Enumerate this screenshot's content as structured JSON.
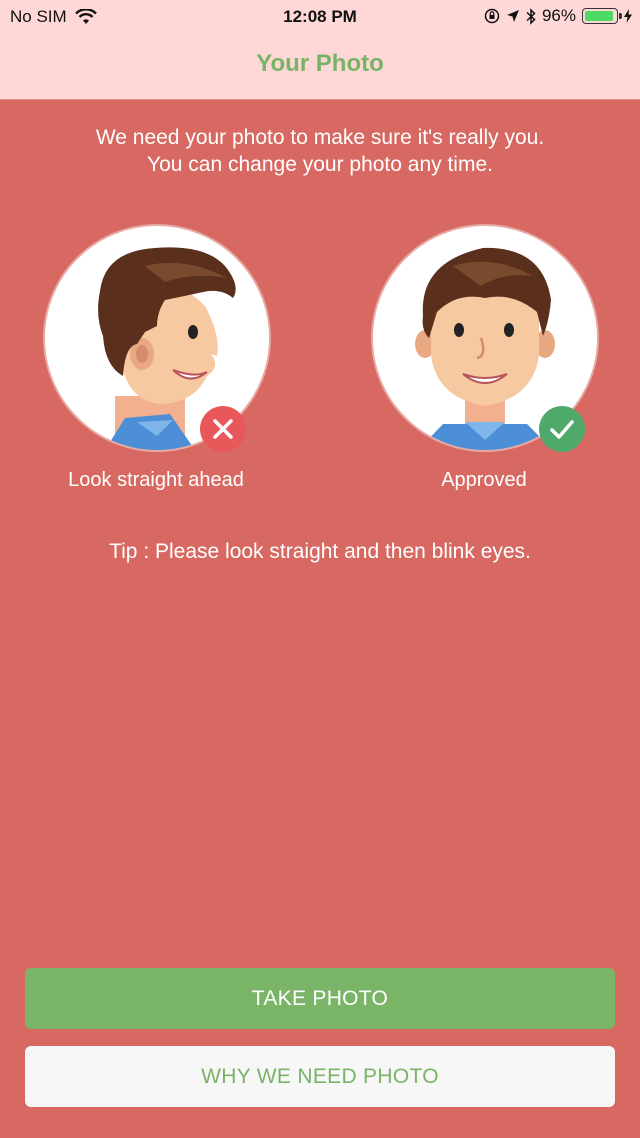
{
  "status_bar": {
    "carrier": "No SIM",
    "time": "12:08 PM",
    "battery_percent": "96%",
    "battery_level": 0.96,
    "icons": [
      "wifi-icon",
      "orientation-lock-icon",
      "location-arrow-icon",
      "bluetooth-icon",
      "battery-icon",
      "charging-bolt-icon"
    ]
  },
  "header": {
    "title": "Your Photo"
  },
  "intro": {
    "line1": "We need your photo to make sure it's really you.",
    "line2": "You can change your photo any time."
  },
  "examples": [
    {
      "caption": "Look straight ahead",
      "badge_icon": "cross-icon",
      "badge_color": "#e8585b"
    },
    {
      "caption": "Approved",
      "badge_icon": "check-icon",
      "badge_color": "#4fa96a"
    }
  ],
  "tip": "Tip : Please look straight and then blink eyes.",
  "buttons": {
    "take_photo": "TAKE PHOTO",
    "why_need_photo": "WHY WE NEED PHOTO"
  },
  "colors": {
    "background": "#d76962",
    "header_bg": "#fdd8d6",
    "accent_green": "#79b466"
  }
}
